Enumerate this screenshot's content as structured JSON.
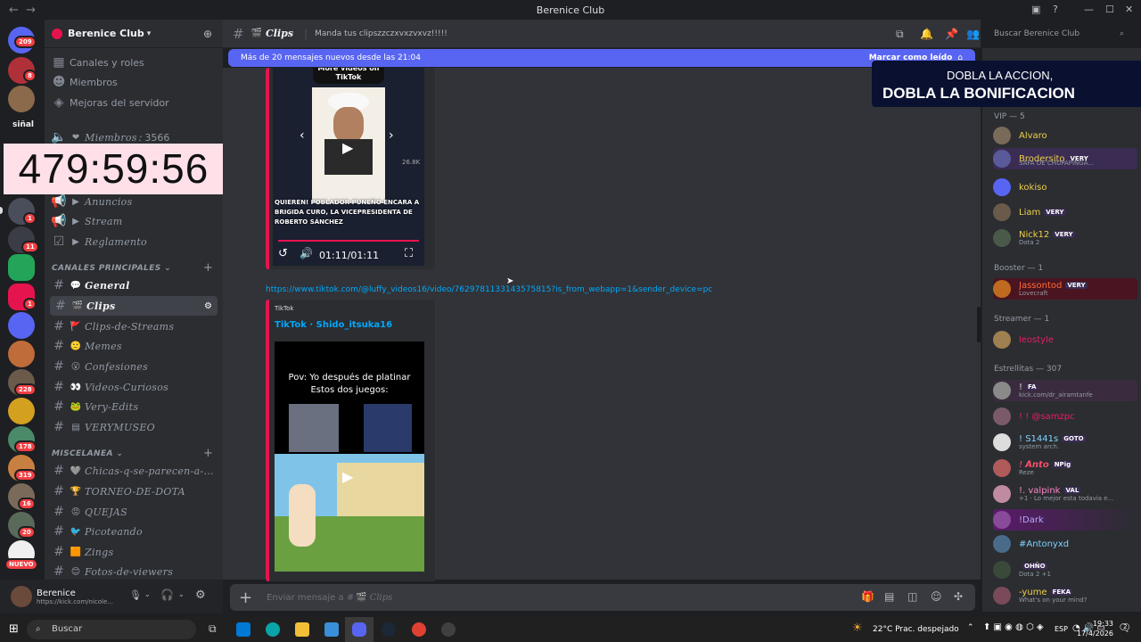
{
  "window": {
    "title": "Berenice Club"
  },
  "server": {
    "name": "Berenice Club"
  },
  "rail_badges": [
    "209",
    "8",
    "1",
    "11",
    "1",
    "228",
    "178",
    "319",
    "16",
    "20",
    "NUEVO"
  ],
  "rail_label": "siñal",
  "sidebar_top": [
    "Canales y roles",
    "Miembros",
    "Mejoras del servidor"
  ],
  "sidebar_stat": {
    "label": "Miembros",
    "value": "3566"
  },
  "timer": "479:59:56",
  "channels_top": [
    {
      "name": "Anuncios"
    },
    {
      "name": "Stream"
    },
    {
      "name": "Reglamento"
    }
  ],
  "cat_principal": "CANALES PRINCIPALES",
  "channels_principal": [
    {
      "name": "General",
      "emoji": "💬"
    },
    {
      "name": "Clips",
      "emoji": "🎬"
    },
    {
      "name": "Clips-de-Streams",
      "emoji": "🚩"
    },
    {
      "name": "Memes",
      "emoji": "🙂"
    },
    {
      "name": "Confesiones",
      "emoji": "😮"
    },
    {
      "name": "Videos-Curiosos",
      "emoji": "👀"
    },
    {
      "name": "Very-Edits",
      "emoji": "🐸"
    },
    {
      "name": "VERYMUSEO",
      "emoji": "▤"
    }
  ],
  "cat_misc": "MISCELANEA",
  "channels_misc": [
    {
      "name": "Chicas-q-se-parecen-a-...",
      "emoji": "🩶"
    },
    {
      "name": "TORNEO-DE-DOTA",
      "emoji": "🏆"
    },
    {
      "name": "QUEJAS",
      "emoji": "😡"
    },
    {
      "name": "Picoteando",
      "emoji": "🐦"
    },
    {
      "name": "Zings",
      "emoji": "🟧"
    },
    {
      "name": "Fotos-de-viewers",
      "emoji": "😊"
    }
  ],
  "user": {
    "name": "Berenice",
    "status": "https://kick.com/nicole..."
  },
  "chat_header": {
    "channel": "Clips",
    "topic": "Manda tus clipszzczxvxzvxvz!!!!!"
  },
  "banner": {
    "text": "Más de 20 mensajes nuevos desde las 21:04",
    "action": "Marcar como leído"
  },
  "video1": {
    "top_text": "More videos on TikTok",
    "caption": "QUIEREN! POBLADOR PUNEÑO ENCARA A BRIGIDA CURO, LA VICEPRESIDENTA DE ROBERTO SÁNCHEZ",
    "time": "01:11/01:11",
    "likes": "26.8K"
  },
  "link": "https://www.tiktok.com/@luffy_videos16/video/7629781133143575815?is_from_webapp=1&sender_device=pc",
  "embed2": {
    "provider": "TikTok",
    "title": "TikTok · Shido_itsuka16",
    "video_text": "Pov: Yo después de platinar Estos dos juegos:"
  },
  "input_placeholder": "Enviar mensaje a #",
  "input_channel": "Clips",
  "search_placeholder": "Buscar Berenice Club",
  "promo": {
    "line1": "DOBLA LA ACCION,",
    "line2": "DOBLA LA BONIFICACION"
  },
  "member_groups": [
    {
      "label": "VIP — 5"
    },
    {
      "label": "Booster — 1"
    },
    {
      "label": "Streamer — 1"
    },
    {
      "label": "Estrellitas — 307"
    }
  ],
  "members": [
    {
      "name": "Alvaro",
      "color": "#f0d04a"
    },
    {
      "name": "Brodersito",
      "color": "#f0d04a",
      "tag": "VERY",
      "sub": "SAFA OE CHUPAPINGA..."
    },
    {
      "name": "kokiso",
      "color": "#f0d04a"
    },
    {
      "name": "Liam",
      "color": "#f0d04a",
      "tag": "VERY"
    },
    {
      "name": "Nick12",
      "color": "#f0d04a",
      "tag": "VERY",
      "sub": "Dota 2"
    },
    {
      "name": "Jassontod",
      "color": "#ff6b35",
      "tag": "VERY",
      "sub": "Lovecraft"
    },
    {
      "name": "leostyle",
      "color": "#e91e63"
    },
    {
      "name": "!",
      "color": "#dbdee1",
      "tag": "FA",
      "sub": "kick.com/dr_airamtanfe"
    },
    {
      "name": "! ! @samzpc",
      "color": "#e91e63"
    },
    {
      "name": "! S1441s",
      "color": "#7fd4ff",
      "tag": "GOTO",
      "sub": "system arch."
    },
    {
      "name": "! 𝘼𝙣𝙩𝙤",
      "color": "#ff4f6d",
      "tag": "NPig",
      "sub": "Reze"
    },
    {
      "name": "!. valpink",
      "color": "#ff86c8",
      "tag": "VAL",
      "sub": "+1 · Lo mejor esta todavia e..."
    },
    {
      "name": "!Dark",
      "color": "#b9a9ff"
    },
    {
      "name": "#Antonyxd",
      "color": "#7fd4ff"
    },
    {
      "name": "",
      "color": "#ff4f6d",
      "tag": "OHÑO",
      "sub": "Dota 2 +1"
    },
    {
      "name": "-yume",
      "color": "#f0d04a",
      "tag": "FEKA",
      "sub": "What's on your mind?"
    }
  ],
  "taskbar": {
    "search": "Buscar",
    "weather": "22°C  Prac. despejado",
    "lang": "ESP",
    "time": "19:33",
    "date": "17/4/2026",
    "notif": "2"
  }
}
